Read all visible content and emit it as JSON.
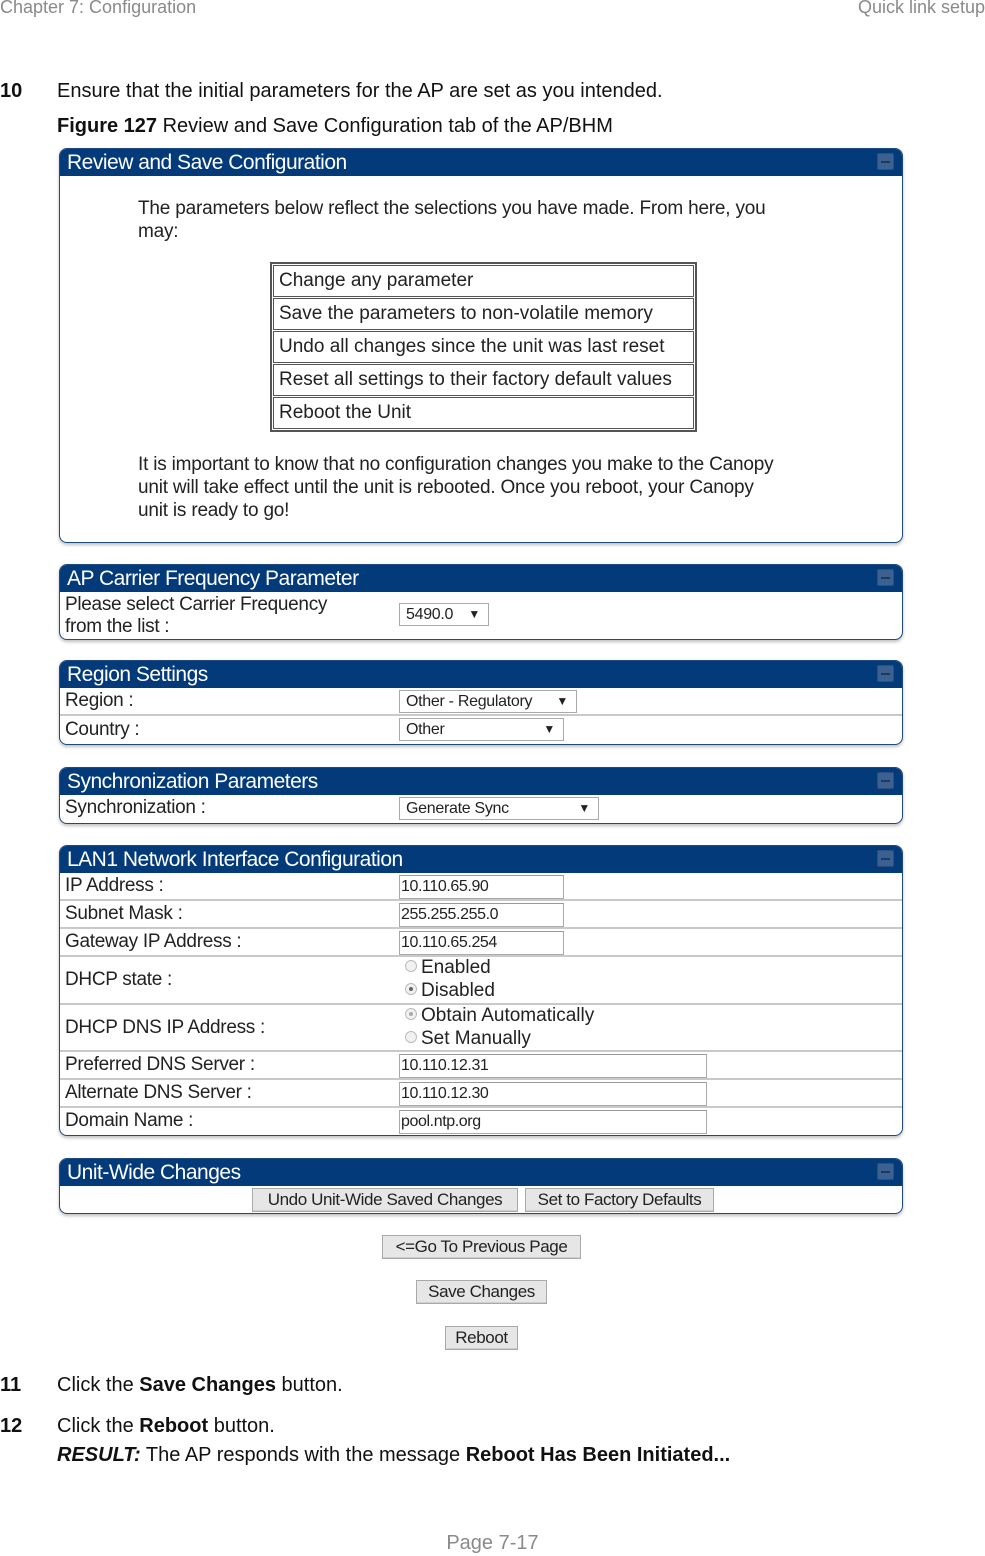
{
  "header": {
    "chapter": "Chapter 7:  Configuration",
    "section": "Quick link setup"
  },
  "steps": {
    "s10": {
      "number": "10",
      "text": "Ensure that the initial parameters for the AP are set as you intended."
    },
    "figure": {
      "label": "Figure 127",
      "caption": " Review and Save Configuration tab of the AP/BHM"
    },
    "s11": {
      "number": "11",
      "prefix": "Click the ",
      "bold": "Save Changes",
      "suffix": " button."
    },
    "s12": {
      "number": "12",
      "prefix": "Click the ",
      "bold": "Reboot",
      "suffix": " button."
    },
    "result": {
      "label": "RESULT:",
      "text": " The AP responds with the message ",
      "bold": "Reboot Has Been Initiated..."
    }
  },
  "review_panel": {
    "title": "Review and Save Configuration",
    "intro_line1": "The parameters below reflect the selections you have made. From here, you",
    "intro_line2": "may:",
    "options": [
      "Change any parameter",
      "Save the parameters to non-volatile memory",
      "Undo all changes since the unit was last reset",
      "Reset all settings to their factory default values",
      "Reboot the Unit"
    ],
    "note_line1": "It is important to know that no configuration changes you make to the Canopy",
    "note_line2": "unit will take effect until the unit is rebooted. Once you reboot, your Canopy",
    "note_line3": "unit is ready to go!"
  },
  "carrier_panel": {
    "title": "AP Carrier Frequency Parameter",
    "label_line1": "Please select Carrier Frequency",
    "label_line2": "from the list :",
    "value": "5490.0"
  },
  "region_panel": {
    "title": "Region Settings",
    "region_label": "Region :",
    "region_value": "Other - Regulatory",
    "country_label": "Country :",
    "country_value": "Other"
  },
  "sync_panel": {
    "title": "Synchronization Parameters",
    "sync_label": "Synchronization :",
    "sync_value": "Generate Sync"
  },
  "lan_panel": {
    "title": "LAN1 Network Interface Configuration",
    "ip_label": "IP Address :",
    "ip_value": "10.110.65.90",
    "mask_label": "Subnet Mask :",
    "mask_value": "255.255.255.0",
    "gateway_label": "Gateway IP Address :",
    "gateway_value": "10.110.65.254",
    "dhcp_label": "DHCP state :",
    "dhcp_options": [
      "Enabled",
      "Disabled"
    ],
    "dhcp_selected": "Disabled",
    "dns_label": "DHCP DNS IP Address :",
    "dns_options": [
      "Obtain Automatically",
      "Set Manually"
    ],
    "dns_selected": "Obtain Automatically",
    "pref_dns_label": "Preferred DNS Server :",
    "pref_dns_value": "10.110.12.31",
    "alt_dns_label": "Alternate DNS Server :",
    "alt_dns_value": "10.110.12.30",
    "domain_label": "Domain Name :",
    "domain_value": "pool.ntp.org"
  },
  "unitwide_panel": {
    "title": "Unit-Wide Changes",
    "undo_button": "Undo Unit-Wide Saved Changes",
    "factory_button": "Set to Factory Defaults"
  },
  "buttons": {
    "previous": "<=Go To Previous Page",
    "save": "Save Changes",
    "reboot": "Reboot"
  },
  "footer": {
    "page": "Page 7-17"
  }
}
